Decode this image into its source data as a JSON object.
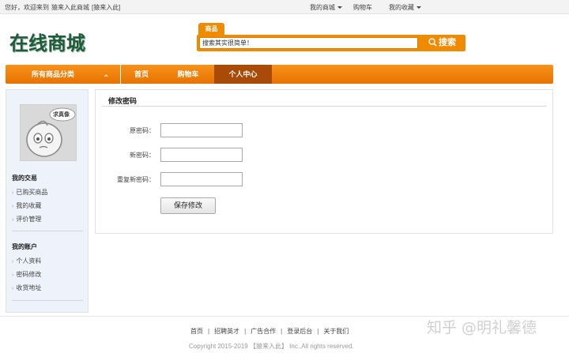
{
  "topbar": {
    "welcome": "您好，欢迎来到",
    "brand": "猿来入此商城",
    "login": "[猿来入此]",
    "my_mall": "我的商城",
    "cart": "购物车",
    "favorites": "我的收藏"
  },
  "header": {
    "logo": "在线商城",
    "search_tab": "商品",
    "search_value": "搜索其实很简单！",
    "search_button": "搜索"
  },
  "nav": {
    "categories": "所有商品分类",
    "items": [
      "首页",
      "购物车",
      "个人中心"
    ],
    "active_index": 2
  },
  "sidebar": {
    "avatar_caption": "求真像",
    "section1_title": "我的交易",
    "section1_items": [
      "已购买商品",
      "我的收藏",
      "评价管理"
    ],
    "section2_title": "我的账户",
    "section2_items": [
      "个人资料",
      "密码修改",
      "收货地址"
    ]
  },
  "main": {
    "title": "修改密码",
    "fields": [
      {
        "label": "原密码：",
        "value": ""
      },
      {
        "label": "新密码：",
        "value": ""
      },
      {
        "label": "重复新密码：",
        "value": ""
      }
    ],
    "save_button": "保存修改"
  },
  "footer": {
    "links": [
      "首页",
      "招聘英才",
      "广告合作",
      "登录后台",
      "关于我们"
    ],
    "copyright": "Copyright 2015-2019 【猿来入此】 Inc.,All rights reserved.",
    "watermark": "知乎 @明礼馨德"
  },
  "colors": {
    "accent": "#f08a00",
    "nav_active": "#a84a08",
    "logo": "#1f5a3a",
    "sidebar_bg": "#eef3fb"
  }
}
